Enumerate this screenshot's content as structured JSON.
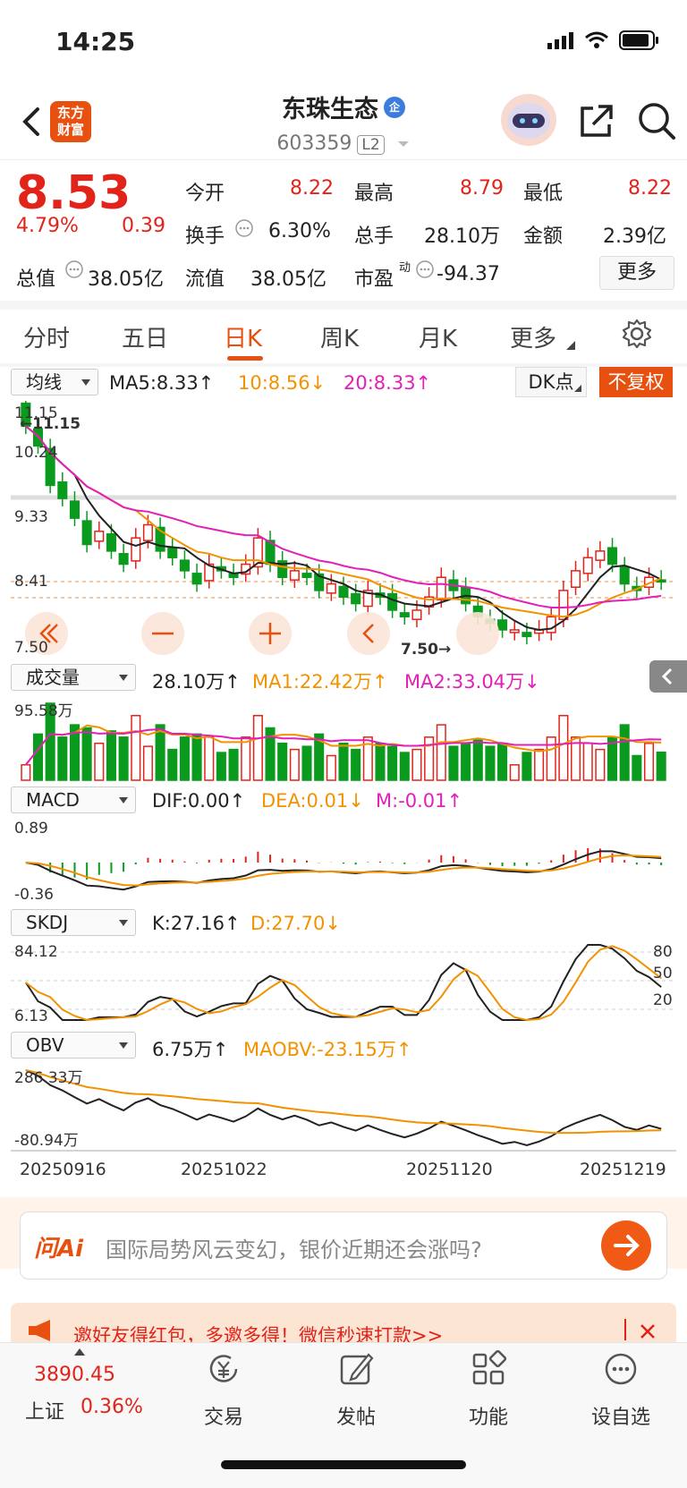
{
  "status": {
    "time": "14:25"
  },
  "header": {
    "stock_name": "东珠生态",
    "badge": "企",
    "stock_code": "603359",
    "level": "L2",
    "logo_line1": "东方",
    "logo_line2": "财富"
  },
  "quote": {
    "price": "8.53",
    "change_pct": "4.79%",
    "change": "0.39",
    "open_label": "今开",
    "open": "8.22",
    "high_label": "最高",
    "high": "8.79",
    "low_label": "最低",
    "low": "8.22",
    "turnover_label": "换手",
    "turnover": "6.30%",
    "volume_label": "总手",
    "volume": "28.10万",
    "amount_label": "金额",
    "amount": "2.39亿",
    "mktcap_label": "总值",
    "mktcap": "38.05亿",
    "float_label": "流值",
    "float": "38.05亿",
    "pe_label": "市盈",
    "pe_sup": "动",
    "pe": "-94.37",
    "more": "更多"
  },
  "tabs": [
    "分时",
    "五日",
    "日K",
    "周K",
    "月K",
    "更多"
  ],
  "active_tab": "日K",
  "kline": {
    "indicator": "均线",
    "ma5": "MA5:8.33↑",
    "ma10": "10:8.56↓",
    "ma20": "20:8.33↑",
    "dk": "DK点",
    "fq": "不复权",
    "y_top": "11.15",
    "y_top_marker": "←11.15",
    "y_2": "10.24",
    "y_3": "9.33",
    "y_4": "8.41",
    "y_bottom": "7.50",
    "low_marker": "7.50→"
  },
  "volume": {
    "indicator": "成交量",
    "value": "28.10万↑",
    "ma1": "MA1:22.42万↑",
    "ma2": "MA2:33.04万↓",
    "y_top": "95.58万"
  },
  "macd": {
    "indicator": "MACD",
    "dif": "DIF:0.00↑",
    "dea": "DEA:0.01↓",
    "m": "M:-0.01↑",
    "y_top": "0.89",
    "y_bottom": "-0.36"
  },
  "skdj": {
    "indicator": "SKDJ",
    "k": "K:27.16↑",
    "d": "D:27.70↓",
    "y_top": "84.12",
    "y_bottom": "6.13",
    "r80": "80",
    "r50": "50",
    "r20": "20"
  },
  "obv": {
    "indicator": "OBV",
    "value": "6.75万↑",
    "maobv": "MAOBV:-23.15万↑",
    "y_top": "286.33万",
    "y_bottom": "-80.94万"
  },
  "dates": [
    "20250916",
    "20251022",
    "20251120",
    "20251219"
  ],
  "ai": {
    "logo": "问Ai",
    "placeholder": "国际局势风云变幻，银价近期还会涨吗?"
  },
  "promo": {
    "text": "邀好友得红包，多邀多得！微信秒速打款>>"
  },
  "nav": {
    "index_value": "3890.45",
    "index_name": "上证",
    "index_change": "0.36%",
    "items": [
      "交易",
      "发帖",
      "功能",
      "设自选"
    ]
  },
  "colors": {
    "brand": "#e8500f",
    "up": "#e2231a",
    "down": "#0a9a1d",
    "ma10": "#f39200",
    "ma20": "#e21fb7"
  },
  "chart_data": {
    "type": "candlestick",
    "x": [
      "20250916",
      "20251022",
      "20251120",
      "20251219"
    ],
    "ylim": [
      7.5,
      11.15
    ],
    "close": [
      10.9,
      10.6,
      10.0,
      9.8,
      9.5,
      9.1,
      9.3,
      9.0,
      8.8,
      9.2,
      9.4,
      9.0,
      8.9,
      8.7,
      8.5,
      8.8,
      8.7,
      8.6,
      8.8,
      9.2,
      8.8,
      8.6,
      8.7,
      8.6,
      8.4,
      8.5,
      8.3,
      8.2,
      8.4,
      8.3,
      8.1,
      8.0,
      8.1,
      8.3,
      8.6,
      8.4,
      8.2,
      8.0,
      7.9,
      7.8,
      7.8,
      7.7,
      7.8,
      8.0,
      8.4,
      8.7,
      8.9,
      9.0,
      8.8,
      8.5,
      8.4,
      8.6,
      8.53
    ]
  }
}
